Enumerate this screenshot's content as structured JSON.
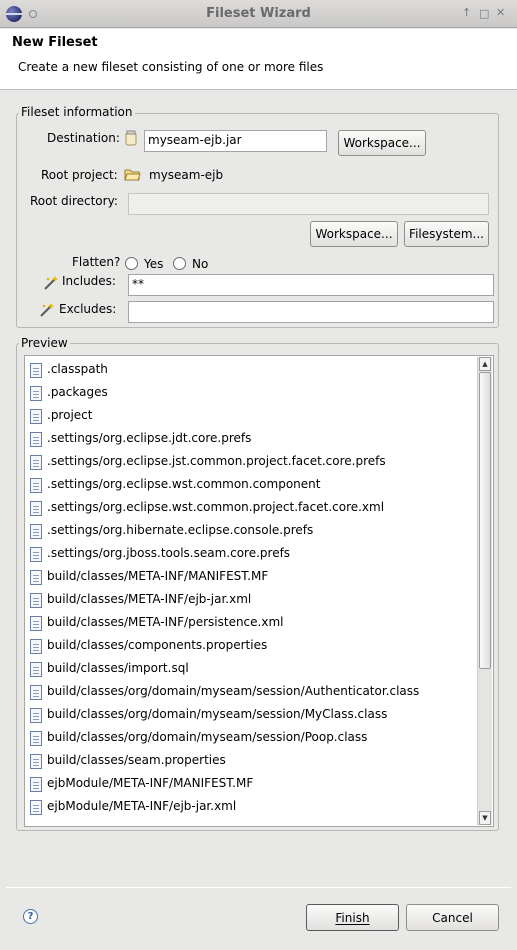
{
  "window": {
    "title": "Fileset Wizard"
  },
  "header": {
    "title": "New Fileset",
    "description": "Create a new fileset consisting of one or more files"
  },
  "fileset_info": {
    "legend": "Fileset information",
    "destination_label": "Destination:",
    "destination_value": "myseam-ejb.jar",
    "workspace_button": "Workspace...",
    "root_project_label": "Root project:",
    "root_project_value": "myseam-ejb",
    "root_directory_label": "Root directory:",
    "root_directory_value": "",
    "workspace_button_2": "Workspace...",
    "filesystem_button": "Filesystem...",
    "flatten_label": "Flatten?",
    "flatten_yes": "Yes",
    "flatten_no": "No",
    "includes_label": "Includes:",
    "includes_value": "**",
    "excludes_label": "Excludes:",
    "excludes_value": ""
  },
  "preview": {
    "legend": "Preview",
    "items": [
      ".classpath",
      ".packages",
      ".project",
      ".settings/org.eclipse.jdt.core.prefs",
      ".settings/org.eclipse.jst.common.project.facet.core.prefs",
      ".settings/org.eclipse.wst.common.component",
      ".settings/org.eclipse.wst.common.project.facet.core.xml",
      ".settings/org.hibernate.eclipse.console.prefs",
      ".settings/org.jboss.tools.seam.core.prefs",
      "build/classes/META-INF/MANIFEST.MF",
      "build/classes/META-INF/ejb-jar.xml",
      "build/classes/META-INF/persistence.xml",
      "build/classes/components.properties",
      "build/classes/import.sql",
      "build/classes/org/domain/myseam/session/Authenticator.class",
      "build/classes/org/domain/myseam/session/MyClass.class",
      "build/classes/org/domain/myseam/session/Poop.class",
      "build/classes/seam.properties",
      "ejbModule/META-INF/MANIFEST.MF",
      "ejbModule/META-INF/ejb-jar.xml"
    ]
  },
  "footer": {
    "help_glyph": "?",
    "finish_button": "Finish",
    "cancel_button": "Cancel"
  }
}
